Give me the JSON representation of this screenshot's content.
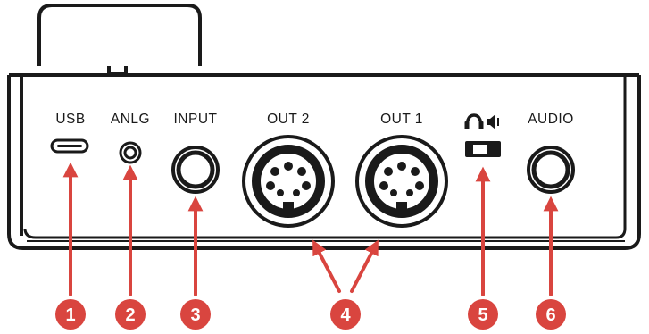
{
  "ports": [
    {
      "label": "USB"
    },
    {
      "label": "ANLG"
    },
    {
      "label": "INPUT"
    },
    {
      "label": "OUT 2"
    },
    {
      "label": "OUT 1"
    },
    {
      "label": "AUDIO"
    }
  ],
  "switch_icons": [
    "headphones-icon",
    "speaker-icon"
  ],
  "callouts": [
    "1",
    "2",
    "3",
    "4",
    "5",
    "6"
  ],
  "colors": {
    "callout": "#d9453f",
    "outline": "#1a1a1a",
    "background": "#ffffff"
  }
}
